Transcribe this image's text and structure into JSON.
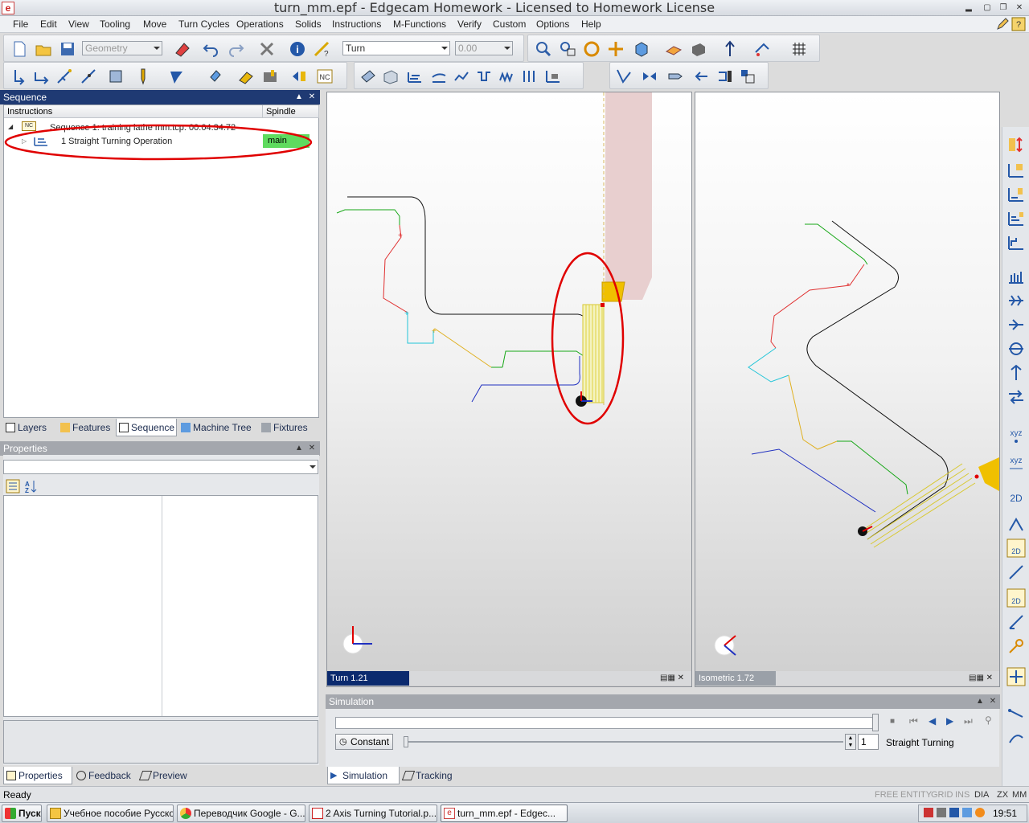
{
  "window": {
    "title": "turn_mm.epf - Edgecam Homework - Licensed to Homework License",
    "app_icon": "e"
  },
  "menu": [
    "File",
    "Edit",
    "View",
    "Tooling",
    "Move",
    "Turn Cycles",
    "Operations",
    "Solids",
    "Instructions",
    "M-Functions",
    "Verify",
    "Custom",
    "Options",
    "Help"
  ],
  "toolbar": {
    "geometry_select": "Geometry",
    "mode_select": "Turn",
    "value_select": "0.00"
  },
  "sequence_panel": {
    "title": "Sequence",
    "col_instructions": "Instructions",
    "col_spindle": "Spindle",
    "nc_badge": "NC",
    "root_label": "Sequence 1: training lathe mm.tcp: 00:04:34.72",
    "op_label": "1  Straight Turning Operation",
    "op_spindle": "main"
  },
  "left_tabs": [
    "Layers",
    "Features",
    "Sequence",
    "Machine Tree",
    "Fixtures"
  ],
  "properties_panel": {
    "title": "Properties"
  },
  "bottom_left_tabs": [
    "Properties",
    "Feedback",
    "Preview"
  ],
  "viewports": {
    "left_label": "Turn 1.21",
    "right_label": "Isometric 1.72"
  },
  "simulation": {
    "title": "Simulation",
    "constant_btn": "Constant",
    "spin_value": "1",
    "op_name": "Straight Turning",
    "tabs": [
      "Simulation",
      "Tracking"
    ]
  },
  "status": {
    "text": "Ready",
    "indicators": [
      "FREE",
      "ENTITY",
      "GRID",
      "INS",
      "DIA",
      "ZX",
      "MM"
    ]
  },
  "taskbar": {
    "start": "Пуск",
    "items": [
      "Учебное пособие Русское",
      "Переводчик Google - G...",
      "2 Axis Turning Tutorial.p...",
      "turn_mm.epf - Edgec..."
    ],
    "clock": "19:51"
  },
  "colors": {
    "panel_header": "#1f3a73",
    "spindle_badge": "#5fdb5f",
    "annotation": "#e00000"
  }
}
